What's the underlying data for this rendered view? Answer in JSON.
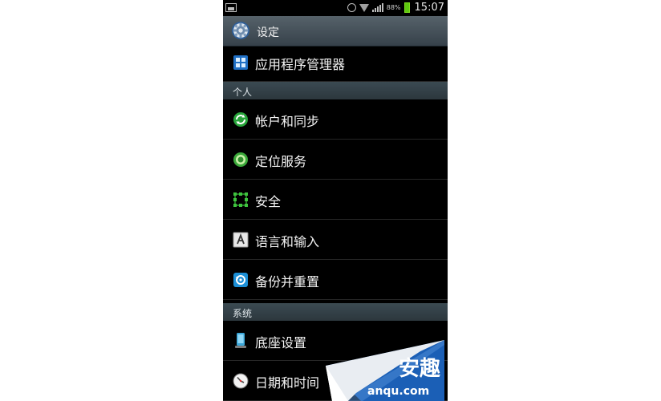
{
  "status_bar": {
    "battery_pct": "88%",
    "time": "15:07",
    "battery_color": "#5ec80f"
  },
  "header": {
    "title": "设定",
    "icon": "gear-icon"
  },
  "items": [
    {
      "label": "应用程序管理器",
      "icon": "app-manager-icon"
    },
    {
      "label": "帐户和同步",
      "icon": "sync-icon"
    },
    {
      "label": "定位服务",
      "icon": "location-icon"
    },
    {
      "label": "安全",
      "icon": "security-icon"
    },
    {
      "label": "语言和输入",
      "icon": "language-icon"
    },
    {
      "label": "备份并重置",
      "icon": "backup-icon"
    },
    {
      "label": "底座设置",
      "icon": "dock-icon"
    },
    {
      "label": "日期和时间",
      "icon": "clock-icon"
    }
  ],
  "sections": {
    "personal": "个人",
    "system": "系统"
  },
  "watermark": {
    "chars": "安趣",
    "domain": "anqu.com"
  }
}
